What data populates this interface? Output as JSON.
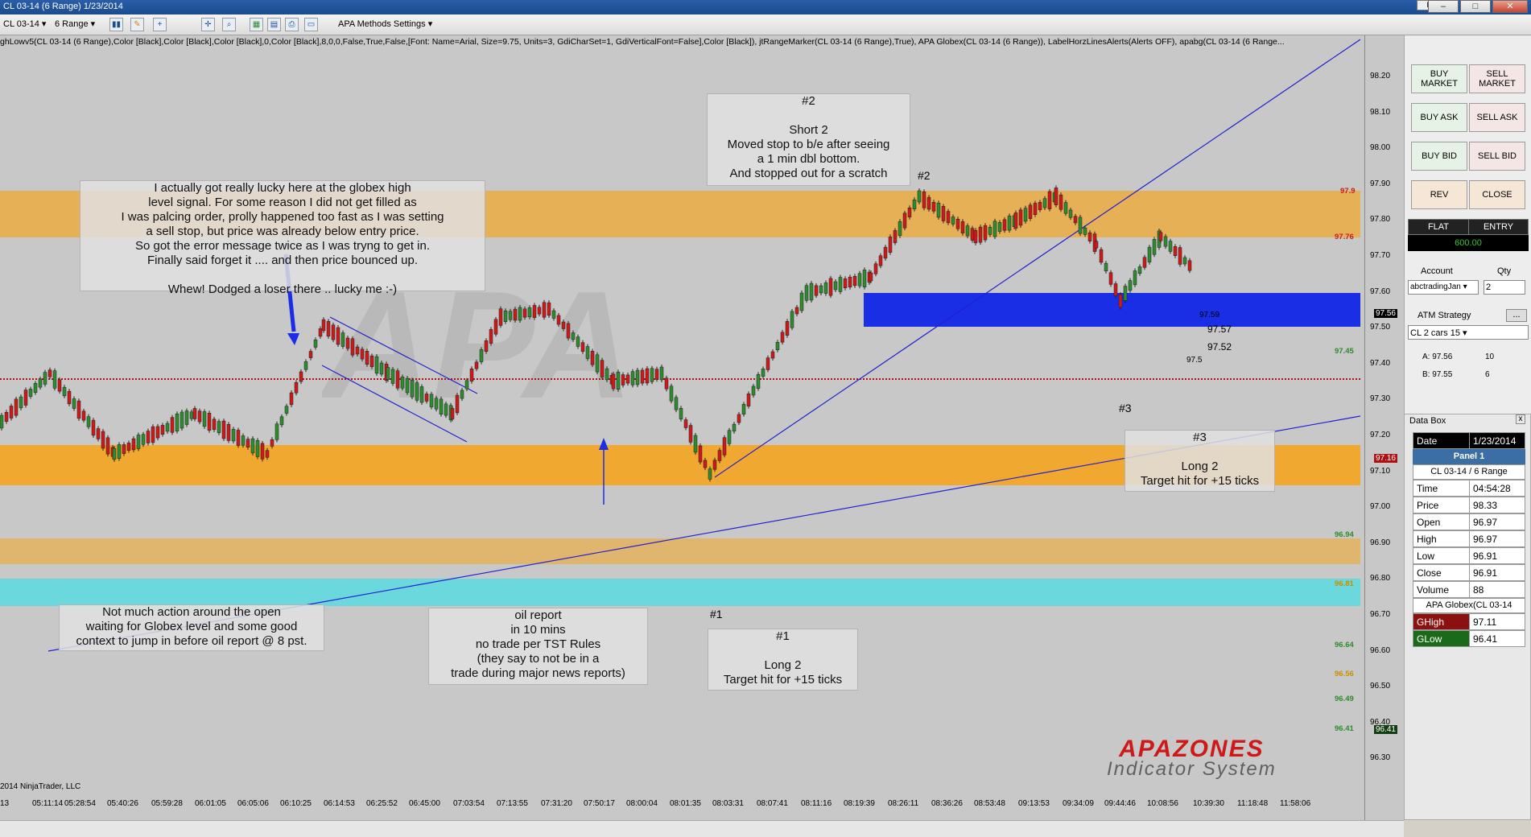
{
  "window": {
    "title": "CL 03-14 (6 Range)  1/23/2014",
    "mini_btn": "L",
    "min": "–",
    "max": "□",
    "close": "✕"
  },
  "toolbar": {
    "instrument": "CL 03-14",
    "period": "6 Range",
    "settings": "APA Methods Settings"
  },
  "indicators_text": "ghLowv5(CL 03-14 (6 Range),Color [Black],Color [Black],Color [Black],0,Color [Black],8,0,0,False,True,False,[Font: Name=Arial, Size=9.75, Units=3, GdiCharSet=1, GdiVerticalFont=False],Color [Black]), jtRangeMarker(CL 03-14 (6 Range),True), APA Globex(CL 03-14 (6 Range)), LabelHorzLinesAlerts(Alerts OFF), apabg(CL 03-14 (6 Range...",
  "y_ticks": [
    "98.20",
    "98.10",
    "98.00",
    "97.90",
    "97.80",
    "97.70",
    "97.60",
    "97.50",
    "97.40",
    "97.30",
    "97.20",
    "97.10",
    "97.00",
    "96.90",
    "96.80",
    "96.70",
    "96.60",
    "96.50",
    "96.40",
    "96.30"
  ],
  "x_ticks": [
    "13",
    "05:11:14",
    "05:28:54",
    "05:40:26",
    "05:59:28",
    "06:01:05",
    "06:05:06",
    "06:10:25",
    "06:14:53",
    "06:25:52",
    "06:45:00",
    "07:03:54",
    "07:13:55",
    "07:31:20",
    "07:50:17",
    "08:00:04",
    "08:01:35",
    "08:03:31",
    "08:07:41",
    "08:11:16",
    "08:19:39",
    "08:26:11",
    "08:36:26",
    "08:53:48",
    "09:13:53",
    "09:34:09",
    "09:44:46",
    "10:08:56",
    "10:39:30",
    "11:18:48",
    "11:58:06"
  ],
  "level_labels": {
    "l979": "97.9",
    "l9776": "97.76",
    "l9745": "97.45",
    "l9694": "96.94",
    "l9681": "96.81",
    "l9664": "96.64",
    "l9656": "96.56",
    "l9649": "96.49",
    "l9641": "96.41"
  },
  "price_tags": {
    "last": "97.56",
    "line": "97.16",
    "low": "96.41"
  },
  "bar_labels": {
    "a": "97.59",
    "b": "97.57",
    "c": "97.52",
    "d": "97.5"
  },
  "copyright": "2014 NinjaTrader, LLC",
  "notes": {
    "globex": "I actually got really lucky here at the globex high\nlevel signal. For some reason I did not get filled as\nI was palcing order, prolly happened too fast as I was setting\na sell stop, but price was already below entry price.\nSo got the error message twice as I was tryng to get in.\nFinally said forget it .... and then price bounced up.\n\nWhew! Dodged a loser there .. lucky me  :-)",
    "short2": "#2\n\nShort 2\nMoved stop to b/e after seeing\na 1 min dbl bottom.\nAnd stopped out for a scratch",
    "long3": "#3\n\nLong 2\nTarget hit for +15 ticks",
    "open": "Not much action around the open\nwaiting for Globex level and some good\ncontext to jump in before oil report @ 8 pst.",
    "oil": "oil report\nin 10 mins\nno trade per TST Rules\n(they say to not be in a\ntrade during major news reports)",
    "long1": "#1\n\nLong 2\nTarget hit for +15 ticks"
  },
  "tags": {
    "t1": "#1",
    "t2": "#2",
    "t3": "#3"
  },
  "logo": {
    "line1": "APAZONES",
    "line2": "Indicator System"
  },
  "panel": {
    "buy_market": "BUY MARKET",
    "sell_market": "SELL MARKET",
    "buy_ask": "BUY ASK",
    "sell_ask": "SELL ASK",
    "buy_bid": "BUY BID",
    "sell_bid": "SELL BID",
    "rev": "REV",
    "close": "CLOSE",
    "flat": "FLAT",
    "entry": "ENTRY",
    "pnl": "600.00",
    "account_label": "Account",
    "qty_label": "Qty",
    "account": "abctradingJan",
    "qty": "2",
    "atm_label": "ATM Strategy",
    "atm_btn": "...",
    "atm": "CL 2 cars 15",
    "ask_label": "A: 97.56",
    "ask_size": "10",
    "bid_label": "B: 97.55",
    "bid_size": "6"
  },
  "databox": {
    "title": "Data Box",
    "close": "x",
    "date_label": "Date",
    "date": "1/23/2014",
    "panel": "Panel 1",
    "instrument": "CL 03-14 / 6 Range",
    "rows": [
      {
        "k": "Time",
        "v": "04:54:28"
      },
      {
        "k": "Price",
        "v": "98.33"
      },
      {
        "k": "Open",
        "v": "96.97"
      },
      {
        "k": "High",
        "v": "96.97"
      },
      {
        "k": "Low",
        "v": "96.91"
      },
      {
        "k": "Close",
        "v": "96.91"
      },
      {
        "k": "Volume",
        "v": "88"
      }
    ],
    "globex": "APA Globex(CL 03-14",
    "ghigh_label": "GHigh",
    "ghigh": "97.11",
    "glow_label": "GLow",
    "glow": "96.41"
  },
  "colors": {
    "orange_zone": "#f0a830",
    "blue_zone": "#1a2ee6",
    "cyan_zone": "#6ad8dc",
    "up": "#2e8b2e",
    "down": "#cc1a1a"
  }
}
